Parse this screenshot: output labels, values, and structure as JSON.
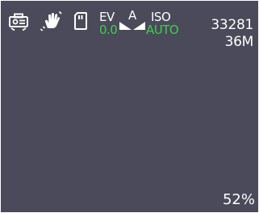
{
  "status_bar": {
    "icons": [
      "camera-mode-icon",
      "image-stabilization-icon",
      "sd-card-icon",
      "metering-icon"
    ],
    "ev": {
      "label": "EV",
      "value": "0.0"
    },
    "metering_letter": "A",
    "iso": {
      "label": "ISO",
      "value": "AUTO"
    }
  },
  "shots_remaining": "33281",
  "resolution": "36M",
  "battery_level": "52%",
  "colors": {
    "background": "#4a4a5a",
    "text": "#ffffff",
    "accent_green": "#3ecf4e"
  }
}
